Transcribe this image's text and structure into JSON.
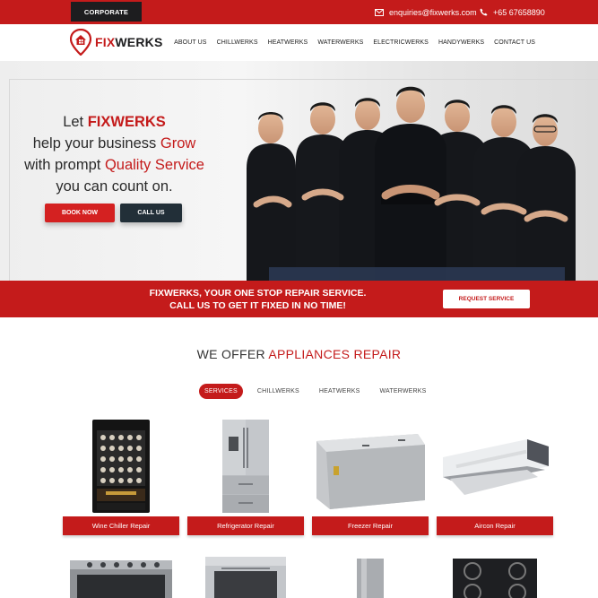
{
  "topbar": {
    "corporate_label": "CORPORATE",
    "email": "enquiries@fixwerks.com",
    "phone": "+65 67658890"
  },
  "header": {
    "logo_fix": "FIX",
    "logo_werks": "WERKS",
    "nav": [
      "ABOUT US",
      "CHILLWERKS",
      "HEATWERKS",
      "WATERWERKS",
      "ELECTRICWERKS",
      "HANDYWERKS",
      "CONTACT US"
    ]
  },
  "hero": {
    "line1_a": "Let ",
    "line1_b": "FIXWERKS",
    "line2_a": "help your business ",
    "line2_b": "Grow",
    "line3_a": "with prompt ",
    "line3_b": "Quality Service",
    "line4": "you can count on.",
    "book_label": "BOOK NOW",
    "call_label": "CALL US"
  },
  "banner": {
    "line1": "FIXWERKS, YOUR ONE STOP REPAIR SERVICE.",
    "line2": "CALL US TO GET IT FIXED IN NO TIME!",
    "request_label": "REQUEST SERVICE"
  },
  "section": {
    "title_a": "WE OFFER ",
    "title_b": "APPLIANCES REPAIR",
    "tabs": [
      "SERVICES",
      "CHILLWERKS",
      "HEATWERKS",
      "WATERWERKS"
    ],
    "products": [
      "Wine Chiller Repair",
      "Refrigerator Repair",
      "Freezer Repair",
      "Aircon Repair"
    ]
  },
  "colors": {
    "brand_red": "#c41b1b",
    "dark": "#1d1d1f"
  }
}
